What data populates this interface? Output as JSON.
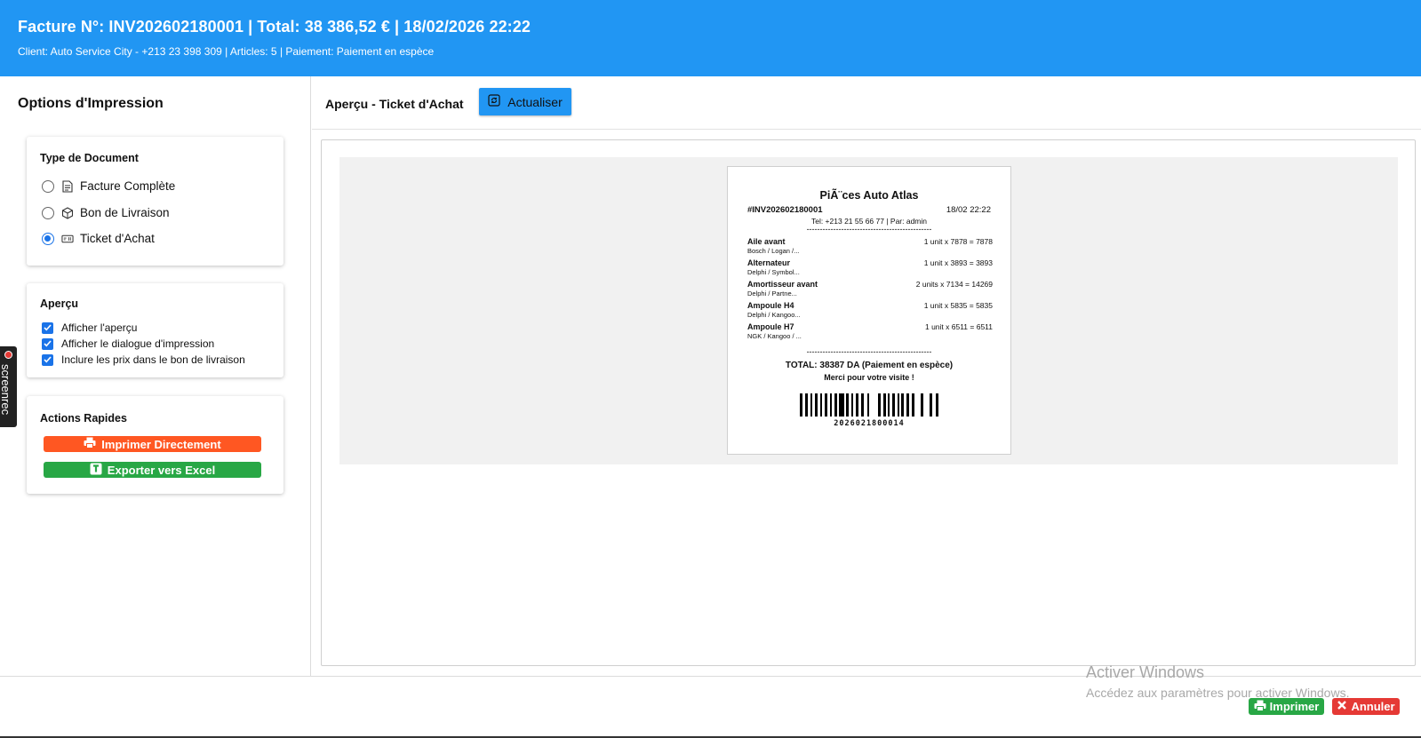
{
  "header": {
    "title": "Facture N°: INV202602180001 | Total: 38 386,52 € | 18/02/2026 22:22",
    "subtitle": "Client: Auto Service City - +213 23 398 309 | Articles: 5 | Paiement: Paiement en espèce"
  },
  "sidebar": {
    "title": "Options d'Impression",
    "doc_type": {
      "title": "Type de Document",
      "options": [
        {
          "label": "Facture Complète",
          "icon": "document-icon",
          "selected": false
        },
        {
          "label": "Bon de Livraison",
          "icon": "package-icon",
          "selected": false
        },
        {
          "label": "Ticket d'Achat",
          "icon": "receipt-icon",
          "selected": true
        }
      ]
    },
    "preview": {
      "title": "Aperçu",
      "options": [
        {
          "label": "Afficher l'aperçu",
          "checked": true
        },
        {
          "label": "Afficher le dialogue d'impression",
          "checked": true
        },
        {
          "label": "Inclure les prix dans le bon de livraison",
          "checked": true
        }
      ]
    },
    "quick_actions": {
      "title": "Actions Rapides",
      "print_label": "Imprimer Directement",
      "excel_label": "Exporter vers Excel",
      "print_color": "#FF5722",
      "excel_color": "#28A745"
    }
  },
  "main": {
    "title": "Aperçu - Ticket d'Achat",
    "refresh_label": "Actualiser",
    "accent": "#2196F3"
  },
  "ticket": {
    "shop": "PiÃ¨ces Auto Atlas",
    "number": "#INV202602180001",
    "date": "18/02 22:22",
    "contact": "Tel: +213 21 55 66 77 | Par: admin",
    "separator": "-----------------------------------------------",
    "items": [
      {
        "name": "Aile avant",
        "qty_line": "1 unit x 7878 = 7878",
        "detail": "Bosch / Logan /..."
      },
      {
        "name": "Alternateur",
        "qty_line": "1 unit x 3893 = 3893",
        "detail": "Delphi / Symbol..."
      },
      {
        "name": "Amortisseur avant",
        "qty_line": "2 units x 7134 = 14269",
        "detail": "Delphi / Partne..."
      },
      {
        "name": "Ampoule H4",
        "qty_line": "1 unit x 5835 = 5835",
        "detail": "Delphi / Kangoo..."
      },
      {
        "name": "Ampoule H7",
        "qty_line": "1 unit x 6511 = 6511",
        "detail": "NGK / Kangoo / ..."
      }
    ],
    "total": "TOTAL: 38387 DA (Paiement en espèce)",
    "thanks": "Merci pour votre visite !",
    "barcode": "2026021800014"
  },
  "footer": {
    "watermark_title": "Activer Windows",
    "watermark_sub": "Accédez aux paramètres pour activer Windows.",
    "print_label": "Imprimer",
    "cancel_label": "Annuler"
  },
  "overlay": {
    "label": "screenrec"
  }
}
